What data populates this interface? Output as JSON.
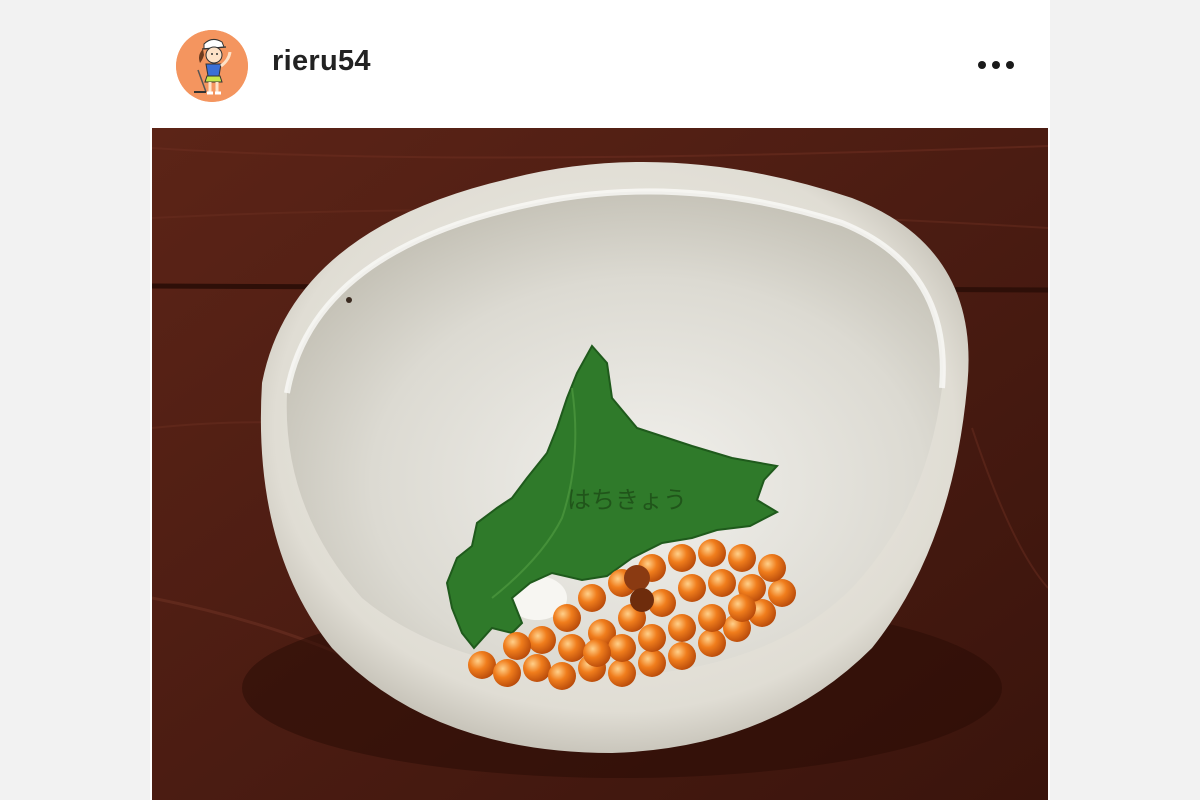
{
  "post": {
    "username": "rieru54",
    "avatar_icon": "golfer-avatar-icon",
    "more_icon": "more-options-icon",
    "avatar_bg": "#f4955f",
    "photo_text": "はちきょう"
  },
  "photo": {
    "subject": "ikura-in-white-bowl",
    "table_color": "#5a2418",
    "bowl_color": "#e6e4de",
    "leaf_color": "#2f7a2a",
    "roe_color": "#e8731a"
  }
}
